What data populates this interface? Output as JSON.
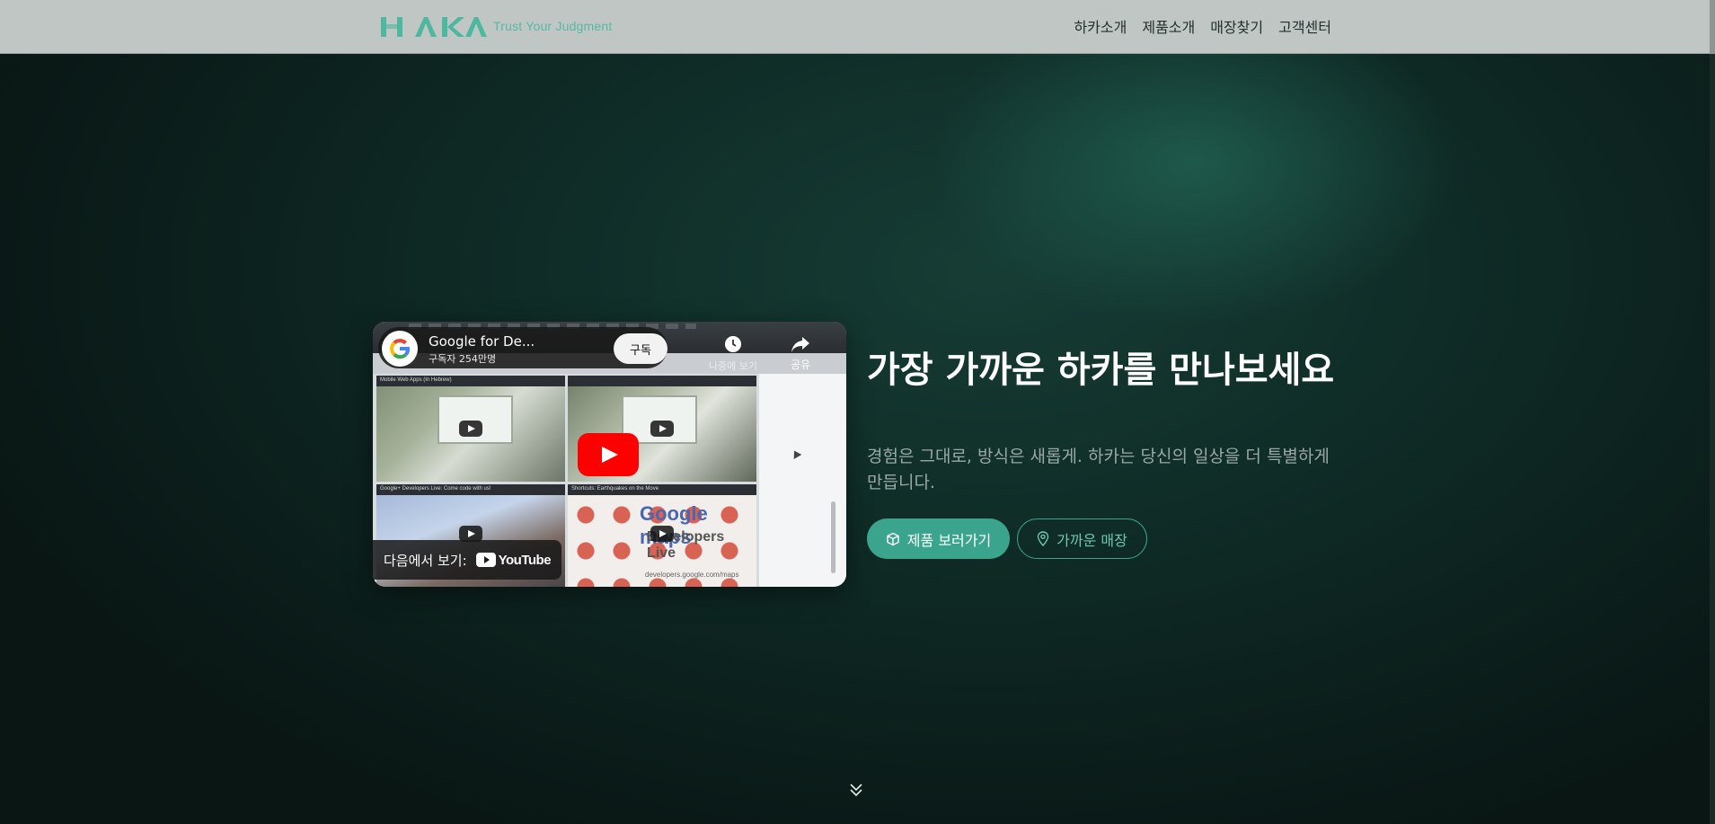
{
  "header": {
    "logo_text": "HAKA",
    "tagline": "Trust Your Judgment",
    "nav": [
      {
        "label": "하카소개"
      },
      {
        "label": "제품소개"
      },
      {
        "label": "매장찾기"
      },
      {
        "label": "고객센터"
      }
    ]
  },
  "video": {
    "channel_title": "Google for De...",
    "subscribers": "구독자 254만명",
    "subscribe_label": "구독",
    "watch_later_label": "나중에 보기",
    "share_label": "공유",
    "watch_on_label": "다음에서 보기:",
    "youtube_word": "YouTube",
    "thumbnails": [
      {
        "caption": "Mobile Web Apps (In Hebrew)"
      },
      {
        "caption": ""
      },
      {
        "caption": "Google+ Developers Live: Come code with us!"
      },
      {
        "caption": "Shortcuts: Earthquakes on the Move"
      }
    ],
    "maps_text": "Google maps",
    "maps_sub": "Developers Live",
    "maps_url": "developers.google.com/maps"
  },
  "hero": {
    "title": "가장 가까운 하카를 만나보세요",
    "subtitle": "경험은 그대로, 방식은 새롭게. 하카는 당신의 일상을 더 특별하게 만듭니다.",
    "primary_button": "제품 보러가기",
    "secondary_button": "가까운 매장"
  },
  "colors": {
    "accent": "#3aa58c",
    "header_bg": "#bfc6c4",
    "logo": "#4db89f"
  },
  "icons": {
    "scroll": "double-chevron-down-icon",
    "primary_button": "box-icon",
    "secondary_button": "map-pin-icon"
  }
}
